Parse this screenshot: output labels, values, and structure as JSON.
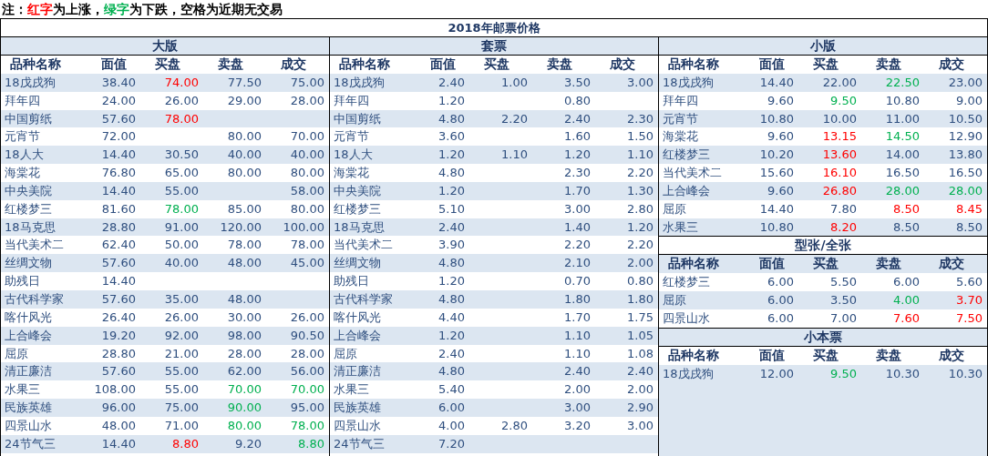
{
  "note": [
    "注：",
    {
      "text": "红字",
      "color": "#ff0000"
    },
    "为上涨，",
    {
      "text": "绿字",
      "color": "#00b050"
    },
    "为下跌，空格为近期无交易"
  ],
  "title": "2018年邮票价格",
  "panels": [
    {
      "sections": [
        {
          "title": "大版",
          "columns": [
            "品种名称",
            "面值",
            "买盘",
            "卖盘",
            "成交"
          ],
          "rows": [
            {
              "cells": [
                "18戊戌狗",
                "38.40",
                {
                  "text": "74.00",
                  "color": "#ff0000"
                },
                "77.50",
                "75.00"
              ]
            },
            {
              "cells": [
                "拜年四",
                "24.00",
                "26.00",
                "29.00",
                "28.00"
              ]
            },
            {
              "cells": [
                "中国剪纸",
                "57.60",
                {
                  "text": "78.00",
                  "color": "#ff0000"
                },
                "",
                ""
              ]
            },
            {
              "cells": [
                "元宵节",
                "72.00",
                "",
                "80.00",
                "70.00"
              ]
            },
            {
              "cells": [
                "18人大",
                "14.40",
                "30.50",
                "40.00",
                "40.00"
              ]
            },
            {
              "cells": [
                "海棠花",
                "76.80",
                "65.00",
                "80.00",
                "80.00"
              ]
            },
            {
              "cells": [
                "中央美院",
                "14.40",
                "55.00",
                "",
                "58.00"
              ]
            },
            {
              "cells": [
                "红楼梦三",
                "81.60",
                {
                  "text": "78.00",
                  "color": "#00b050"
                },
                "85.00",
                "80.00"
              ]
            },
            {
              "cells": [
                "18马克思",
                "28.80",
                "91.00",
                "120.00",
                "100.00"
              ]
            },
            {
              "cells": [
                "当代美术二",
                "62.40",
                "50.00",
                "78.00",
                "78.00"
              ]
            },
            {
              "cells": [
                "丝绸文物",
                "57.60",
                "40.00",
                "48.00",
                "45.00"
              ]
            },
            {
              "cells": [
                "助残日",
                "14.40",
                "",
                "",
                ""
              ]
            },
            {
              "cells": [
                "古代科学家",
                "57.60",
                "35.00",
                "48.00",
                ""
              ]
            },
            {
              "cells": [
                "喀什风光",
                "26.40",
                "26.00",
                "30.00",
                "26.00"
              ]
            },
            {
              "cells": [
                "上合峰会",
                "19.20",
                "92.00",
                "98.00",
                "90.50"
              ]
            },
            {
              "cells": [
                "屈原",
                "28.80",
                "21.00",
                "28.00",
                "28.00"
              ]
            },
            {
              "cells": [
                "清正廉洁",
                "57.60",
                "55.00",
                "62.00",
                "56.00"
              ]
            },
            {
              "cells": [
                "水果三",
                "108.00",
                "55.00",
                {
                  "text": "70.00",
                  "color": "#00b050"
                },
                {
                  "text": "70.00",
                  "color": "#00b050"
                }
              ]
            },
            {
              "cells": [
                "民族英雄",
                "96.00",
                "75.00",
                {
                  "text": "90.00",
                  "color": "#00b050"
                },
                "95.00"
              ]
            },
            {
              "cells": [
                "四景山水",
                "48.00",
                "71.00",
                {
                  "text": "80.00",
                  "color": "#00b050"
                },
                {
                  "text": "78.00",
                  "color": "#00b050"
                }
              ]
            },
            {
              "cells": [
                "24节气三",
                "14.40",
                {
                  "text": "8.80",
                  "color": "#ff0000"
                },
                "9.20",
                {
                  "text": "8.80",
                  "color": "#00b050"
                }
              ]
            }
          ]
        }
      ]
    },
    {
      "sections": [
        {
          "title": "套票",
          "columns": [
            "品种名称",
            "面值",
            "买盘",
            "卖盘",
            "成交"
          ],
          "rows": [
            {
              "cells": [
                "18戊戌狗",
                "2.40",
                "1.00",
                "3.50",
                "3.00"
              ]
            },
            {
              "cells": [
                "拜年四",
                "1.20",
                "",
                "0.80",
                ""
              ]
            },
            {
              "cells": [
                "中国剪纸",
                "4.80",
                "2.20",
                "2.40",
                "2.30"
              ]
            },
            {
              "cells": [
                "元宵节",
                "3.60",
                "",
                "1.60",
                "1.50"
              ]
            },
            {
              "cells": [
                "18人大",
                "1.20",
                "1.10",
                "1.20",
                "1.10"
              ]
            },
            {
              "cells": [
                "海棠花",
                "4.80",
                "",
                "2.30",
                "2.20"
              ]
            },
            {
              "cells": [
                "中央美院",
                "1.20",
                "",
                "1.70",
                "1.30"
              ]
            },
            {
              "cells": [
                "红楼梦三",
                "5.10",
                "",
                "3.00",
                "2.80"
              ]
            },
            {
              "cells": [
                "18马克思",
                "2.40",
                "",
                "1.40",
                "1.20"
              ]
            },
            {
              "cells": [
                "当代美术二",
                "3.90",
                "",
                "2.20",
                "2.20"
              ]
            },
            {
              "cells": [
                "丝绸文物",
                "4.80",
                "",
                "2.10",
                "2.00"
              ]
            },
            {
              "cells": [
                "助残日",
                "1.20",
                "",
                "0.70",
                "0.80"
              ]
            },
            {
              "cells": [
                "古代科学家",
                "4.80",
                "",
                "1.80",
                "1.80"
              ]
            },
            {
              "cells": [
                "喀什风光",
                "4.40",
                "",
                "1.70",
                "1.75"
              ]
            },
            {
              "cells": [
                "上合峰会",
                "1.20",
                "",
                "1.10",
                "1.05"
              ]
            },
            {
              "cells": [
                "屈原",
                "2.40",
                "",
                "1.10",
                "1.08"
              ]
            },
            {
              "cells": [
                "清正廉洁",
                "4.80",
                "",
                "2.40",
                "2.40"
              ]
            },
            {
              "cells": [
                "水果三",
                "5.40",
                "",
                "2.00",
                "2.00"
              ]
            },
            {
              "cells": [
                "民族英雄",
                "6.00",
                "",
                "3.00",
                "2.90"
              ]
            },
            {
              "cells": [
                "四景山水",
                "4.00",
                "2.80",
                "3.20",
                "3.00"
              ]
            },
            {
              "cells": [
                "24节气三",
                "7.20",
                "",
                "",
                ""
              ]
            }
          ]
        }
      ]
    },
    {
      "sections": [
        {
          "title": "小版",
          "columns": [
            "品种名称",
            "面值",
            "买盘",
            "卖盘",
            "成交"
          ],
          "rows": [
            {
              "cells": [
                "18戊戌狗",
                "14.40",
                "22.00",
                {
                  "text": "22.50",
                  "color": "#00b050"
                },
                "23.00"
              ]
            },
            {
              "cells": [
                "拜年四",
                "9.60",
                {
                  "text": "9.50",
                  "color": "#00b050"
                },
                "10.80",
                "9.00"
              ]
            },
            {
              "cells": [
                "元宵节",
                "10.80",
                "10.00",
                "11.00",
                "10.50"
              ]
            },
            {
              "cells": [
                "海棠花",
                "9.60",
                {
                  "text": "13.15",
                  "color": "#ff0000"
                },
                {
                  "text": "14.50",
                  "color": "#00b050"
                },
                "12.90"
              ]
            },
            {
              "cells": [
                "红楼梦三",
                "10.20",
                {
                  "text": "13.60",
                  "color": "#ff0000"
                },
                "14.00",
                "13.80"
              ]
            },
            {
              "cells": [
                "当代美术二",
                "15.60",
                {
                  "text": "16.10",
                  "color": "#ff0000"
                },
                "16.50",
                "16.50"
              ]
            },
            {
              "cells": [
                "上合峰会",
                "9.60",
                {
                  "text": "26.80",
                  "color": "#ff0000"
                },
                {
                  "text": "28.00",
                  "color": "#00b050"
                },
                {
                  "text": "28.00",
                  "color": "#00b050"
                }
              ]
            },
            {
              "cells": [
                "屈原",
                "14.40",
                "7.80",
                {
                  "text": "8.50",
                  "color": "#ff0000"
                },
                {
                  "text": "8.45",
                  "color": "#ff0000"
                }
              ]
            },
            {
              "cells": [
                "水果三",
                "10.80",
                {
                  "text": "8.20",
                  "color": "#ff0000"
                },
                "8.50",
                "8.50"
              ]
            }
          ]
        },
        {
          "title": "型张/全张",
          "columns": [
            "品种名称",
            "面值",
            "买盘",
            "卖盘",
            "成交"
          ],
          "rows": [
            {
              "cells": [
                "红楼梦三",
                "6.00",
                "5.50",
                "6.00",
                "5.60"
              ]
            },
            {
              "cells": [
                "屈原",
                "6.00",
                "3.50",
                {
                  "text": "4.00",
                  "color": "#00b050"
                },
                {
                  "text": "3.70",
                  "color": "#ff0000"
                }
              ]
            },
            {
              "cells": [
                "四景山水",
                "6.00",
                "7.00",
                {
                  "text": "7.60",
                  "color": "#ff0000"
                },
                {
                  "text": "7.50",
                  "color": "#ff0000"
                }
              ]
            }
          ]
        },
        {
          "title": "小本票",
          "columns": [
            "品种名称",
            "面值",
            "买盘",
            "卖盘",
            "成交"
          ],
          "rows": [
            {
              "cells": [
                "18戊戌狗",
                "12.00",
                {
                  "text": "9.50",
                  "color": "#00b050"
                },
                "10.30",
                "10.30"
              ]
            }
          ]
        }
      ]
    }
  ]
}
